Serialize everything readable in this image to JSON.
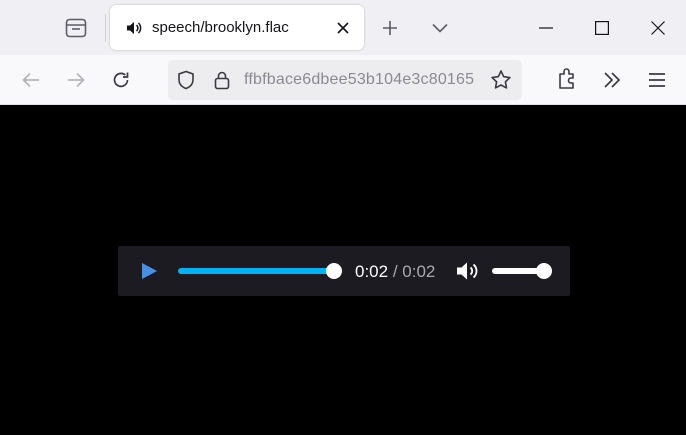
{
  "tab": {
    "title": "speech/brooklyn.flac",
    "icon": "speaker-icon"
  },
  "toolbar": {
    "url": "ffbfbace6dbee53b104e3c80165"
  },
  "player": {
    "current_time": "0:02",
    "separator": "/",
    "duration": "0:02",
    "progress": 1.0,
    "volume": 1.0,
    "state": "paused"
  },
  "colors": {
    "accent": "#00b3f4",
    "play": "#4a90e2",
    "content_bg": "#000000",
    "player_bg": "#1c1b22"
  }
}
